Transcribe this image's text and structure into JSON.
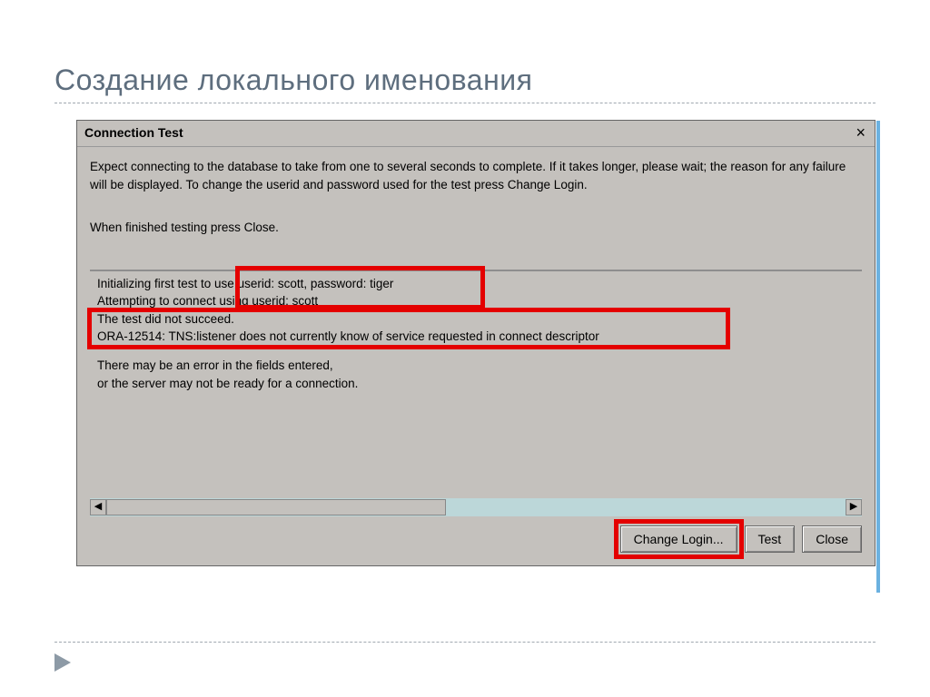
{
  "slide": {
    "title": "Создание локального именования"
  },
  "dialog": {
    "title": "Connection Test",
    "close_glyph": "×",
    "instructions_line1": "Expect connecting to the database to take from one to several seconds to complete. If it takes longer, please wait; the reason for any failure will be displayed. To change the userid and password used for the test press Change Login.",
    "instructions_line2": "When finished testing press Close.",
    "log": {
      "l1": "Initializing first test to use userid: scott, password: tiger",
      "l2": "Attempting to connect using userid:  scott",
      "l3": "The test did not succeed.",
      "l4": "ORA-12514: TNS:listener does not currently know of service requested in connect descriptor",
      "l5": "There may be an error in the fields entered,",
      "l6": "or the server may not be ready for a connection."
    },
    "scroll": {
      "left_glyph": "◀",
      "right_glyph": "▶"
    },
    "buttons": {
      "change_login": "Change Login...",
      "test": "Test",
      "close": "Close"
    }
  }
}
